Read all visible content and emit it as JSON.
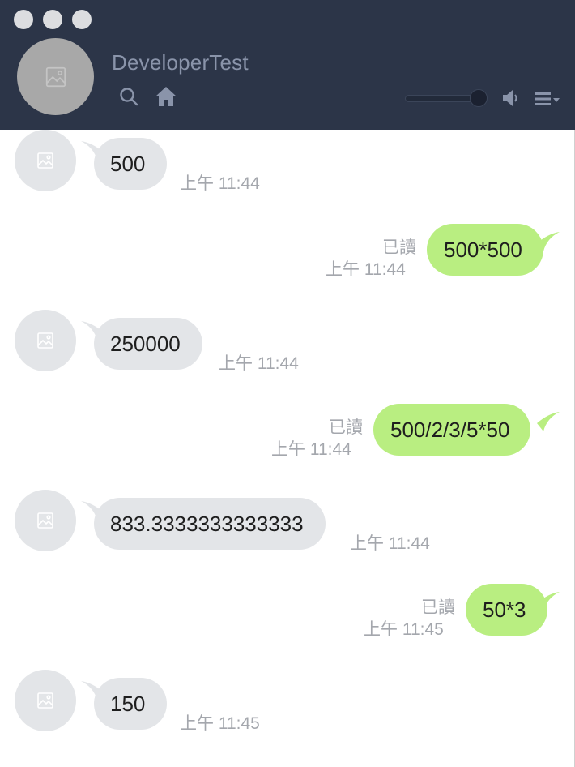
{
  "window": {
    "title": "DeveloperTest"
  },
  "header": {
    "icons": {
      "search": "search-icon",
      "home": "home-icon",
      "speaker": "speaker-icon",
      "menu": "menu-icon"
    },
    "volume_level": 0.9
  },
  "messages": [
    {
      "side": "in",
      "text": "500",
      "time": "上午 11:44"
    },
    {
      "side": "out",
      "text": "500*500",
      "time": "上午 11:44",
      "read": "已讀"
    },
    {
      "side": "in",
      "text": "250000",
      "time": "上午 11:44"
    },
    {
      "side": "out",
      "text": "500/2/3/5*50",
      "time": "上午 11:44",
      "read": "已讀"
    },
    {
      "side": "in",
      "text": "833.3333333333333",
      "time": "上午 11:44"
    },
    {
      "side": "out",
      "text": "50*3",
      "time": "上午 11:45",
      "read": "已讀"
    },
    {
      "side": "in",
      "text": "150",
      "time": "上午 11:45"
    }
  ],
  "colors": {
    "header_bg": "#2c3548",
    "incoming_bubble": "#e3e5e8",
    "outgoing_bubble": "#b9ee81",
    "meta_text": "#a4a7ad"
  }
}
